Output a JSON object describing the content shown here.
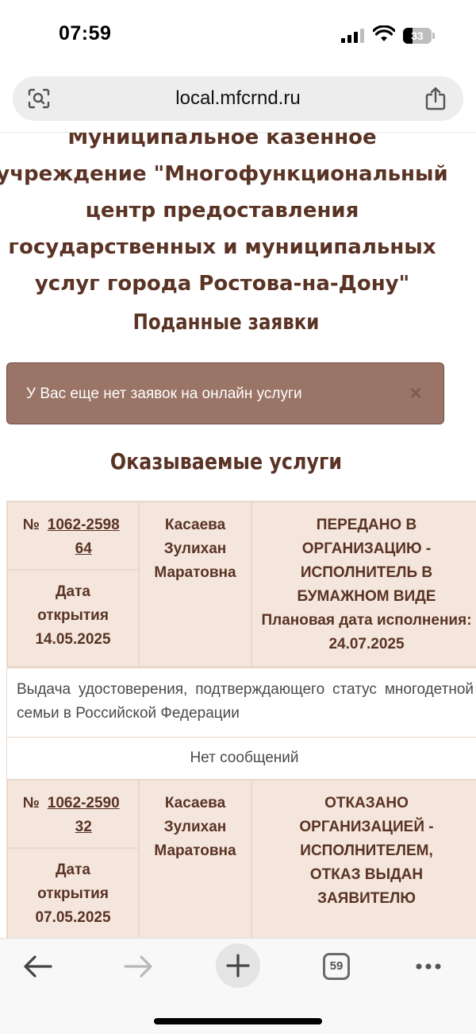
{
  "status_bar": {
    "time": "07:59",
    "battery": "33"
  },
  "browser": {
    "url": "local.mfcrnd.ru",
    "tabs_count": "59"
  },
  "page": {
    "org_title_lines": [
      "Муниципальное казенное",
      "учреждение \"Многофункциональный",
      "центр предоставления",
      "государственных и муниципальных",
      "услуг города Ростова-на-Дону\""
    ],
    "submitted_heading": "Поданные заявки",
    "alert_text": "У Вас еще нет заявок на онлайн услуги",
    "alert_close": "×",
    "services_heading": "Оказываемые услуги"
  },
  "applications": [
    {
      "number_prefix": "№ ",
      "number": "1062-259864",
      "date_label": "Дата открытия",
      "date": "14.05.2025",
      "applicant": "Касаева Зулихан Маратовна",
      "status": "ПЕРЕДАНО В ОРГАНИЗАЦИЮ - ИСПОЛНИТЕЛЬ В БУМАЖНОМ ВИДЕ",
      "planned_date": "Плановая дата исполнения: 24.07.2025",
      "description": "Выдача удостоверения, подтверждающего статус многодетной семьи в Российской Федерации",
      "messages": "Нет сообщений"
    },
    {
      "number_prefix": "№ ",
      "number": "1062-259032",
      "date_label": "Дата открытия",
      "date": "07.05.2025",
      "applicant": "Касаева Зулихан Маратовна",
      "status": "ОТКАЗАНО ОРГАНИЗАЦИЕЙ - ИСПОЛНИТЕЛЕМ, ОТКАЗ ВЫДАН ЗАЯВИТЕЛЮ"
    }
  ]
}
